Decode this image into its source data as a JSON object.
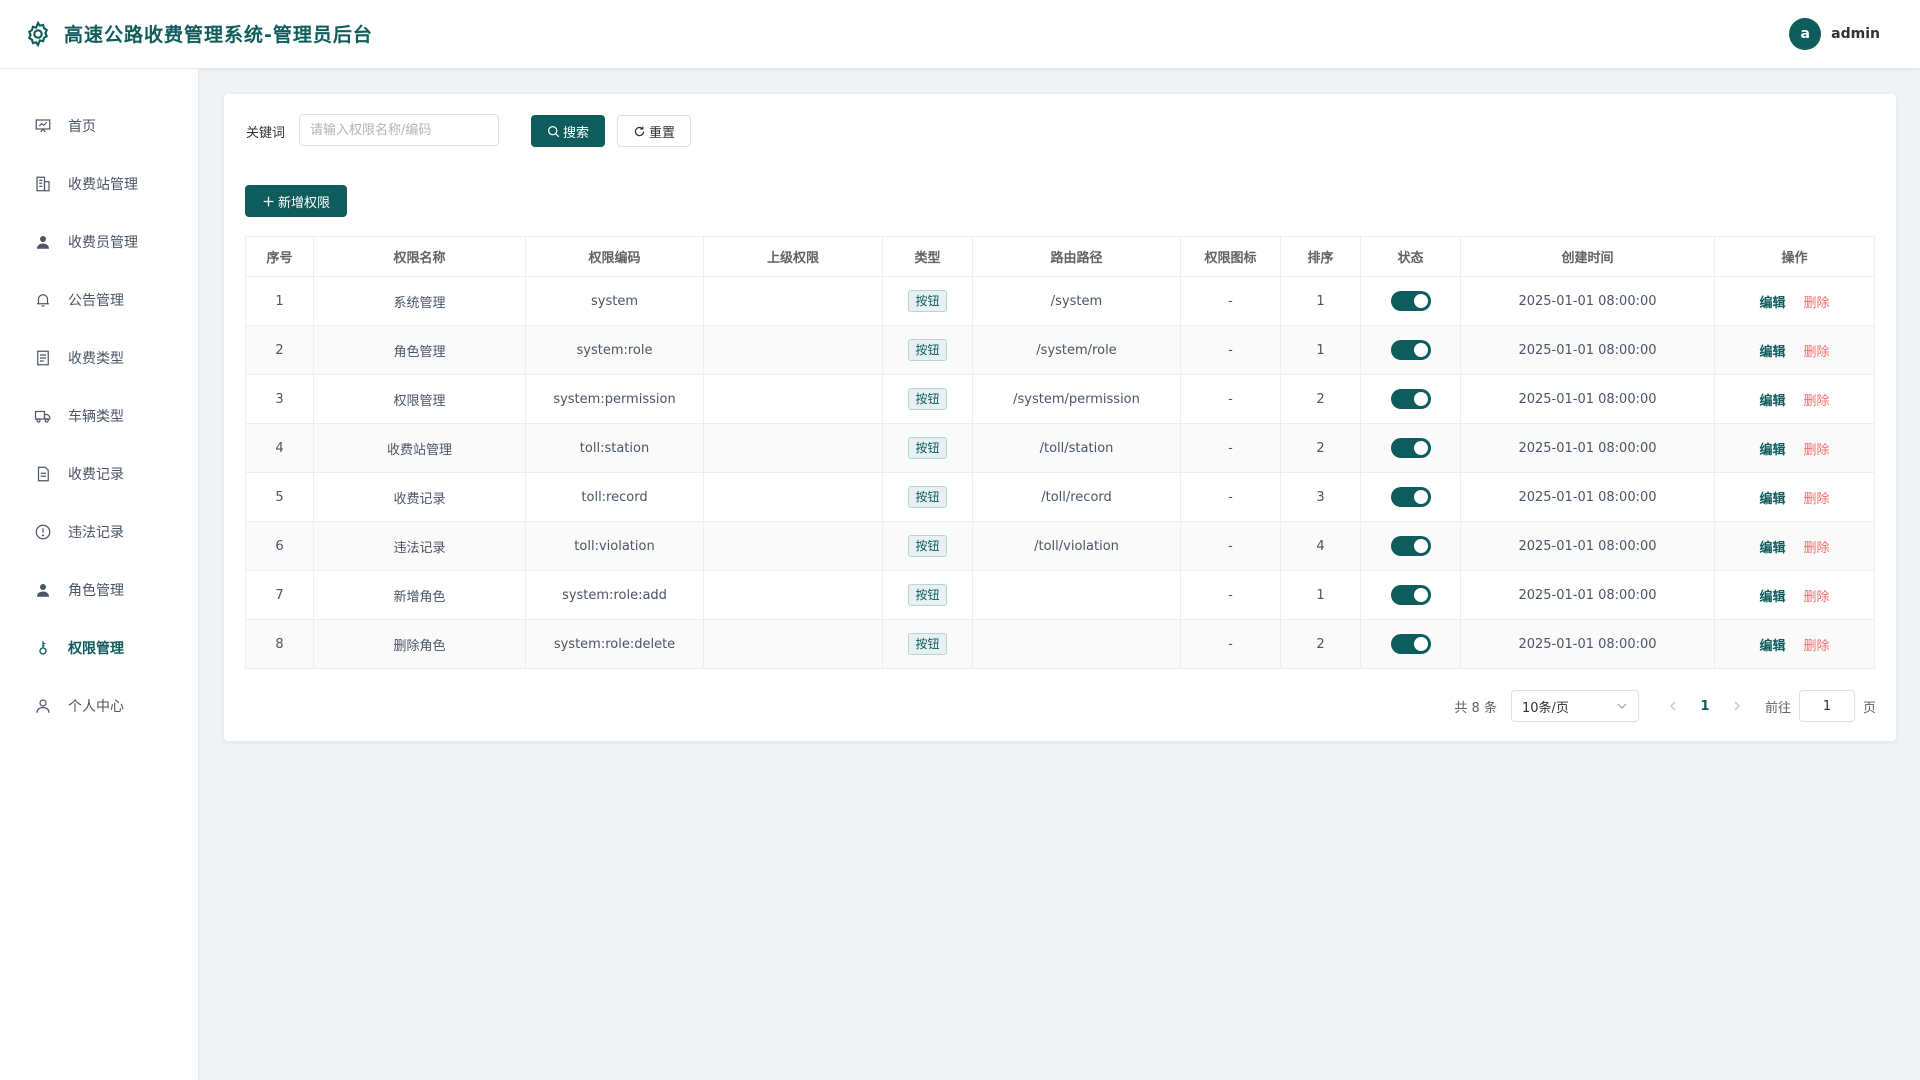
{
  "header": {
    "title": "高速公路收费管理系统-管理员后台",
    "avatar_letter": "a",
    "username": "admin",
    "logo_icon": "gear-icon"
  },
  "sidebar": {
    "items": [
      {
        "label": "首页",
        "icon": "dashboard-icon"
      },
      {
        "label": "收费站管理",
        "icon": "building-icon"
      },
      {
        "label": "收费员管理",
        "icon": "user-icon"
      },
      {
        "label": "公告管理",
        "icon": "bell-icon"
      },
      {
        "label": "收费类型",
        "icon": "list-icon"
      },
      {
        "label": "车辆类型",
        "icon": "truck-icon"
      },
      {
        "label": "收费记录",
        "icon": "document-icon"
      },
      {
        "label": "违法记录",
        "icon": "warning-icon"
      },
      {
        "label": "角色管理",
        "icon": "user-icon"
      },
      {
        "label": "权限管理",
        "icon": "key-icon"
      },
      {
        "label": "个人中心",
        "icon": "person-icon"
      }
    ],
    "active_index": 9
  },
  "search": {
    "label": "关键词",
    "placeholder": "请输入权限名称/编码",
    "value": "",
    "search_label": "搜索",
    "reset_label": "重置"
  },
  "add_button_label": "新增权限",
  "table": {
    "columns": [
      "序号",
      "权限名称",
      "权限编码",
      "上级权限",
      "类型",
      "路由路径",
      "权限图标",
      "排序",
      "状态",
      "创建时间",
      "操作"
    ],
    "edit_label": "编辑",
    "delete_label": "删除",
    "rows": [
      {
        "index": "1",
        "name": "系统管理",
        "code": "system",
        "parent": "",
        "type": "按钮",
        "path": "/system",
        "icon": "-",
        "sort": "1",
        "enabled": true,
        "created": "2025-01-01 08:00:00"
      },
      {
        "index": "2",
        "name": "角色管理",
        "code": "system:role",
        "parent": "",
        "type": "按钮",
        "path": "/system/role",
        "icon": "-",
        "sort": "1",
        "enabled": true,
        "created": "2025-01-01 08:00:00"
      },
      {
        "index": "3",
        "name": "权限管理",
        "code": "system:permission",
        "parent": "",
        "type": "按钮",
        "path": "/system/permission",
        "icon": "-",
        "sort": "2",
        "enabled": true,
        "created": "2025-01-01 08:00:00"
      },
      {
        "index": "4",
        "name": "收费站管理",
        "code": "toll:station",
        "parent": "",
        "type": "按钮",
        "path": "/toll/station",
        "icon": "-",
        "sort": "2",
        "enabled": true,
        "created": "2025-01-01 08:00:00"
      },
      {
        "index": "5",
        "name": "收费记录",
        "code": "toll:record",
        "parent": "",
        "type": "按钮",
        "path": "/toll/record",
        "icon": "-",
        "sort": "3",
        "enabled": true,
        "created": "2025-01-01 08:00:00"
      },
      {
        "index": "6",
        "name": "违法记录",
        "code": "toll:violation",
        "parent": "",
        "type": "按钮",
        "path": "/toll/violation",
        "icon": "-",
        "sort": "4",
        "enabled": true,
        "created": "2025-01-01 08:00:00"
      },
      {
        "index": "7",
        "name": "新增角色",
        "code": "system:role:add",
        "parent": "",
        "type": "按钮",
        "path": "",
        "icon": "-",
        "sort": "1",
        "enabled": true,
        "created": "2025-01-01 08:00:00"
      },
      {
        "index": "8",
        "name": "删除角色",
        "code": "system:role:delete",
        "parent": "",
        "type": "按钮",
        "path": "",
        "icon": "-",
        "sort": "2",
        "enabled": true,
        "created": "2025-01-01 08:00:00"
      }
    ]
  },
  "pagination": {
    "total_text": "共 8 条",
    "page_size": "10条/页",
    "current_page": "1",
    "goto_label": "前往",
    "goto_value": "1",
    "page_suffix": "页"
  },
  "colors": {
    "primary": "#0e5c5c",
    "danger": "#f56c6c",
    "background": "#f0f3f4"
  }
}
